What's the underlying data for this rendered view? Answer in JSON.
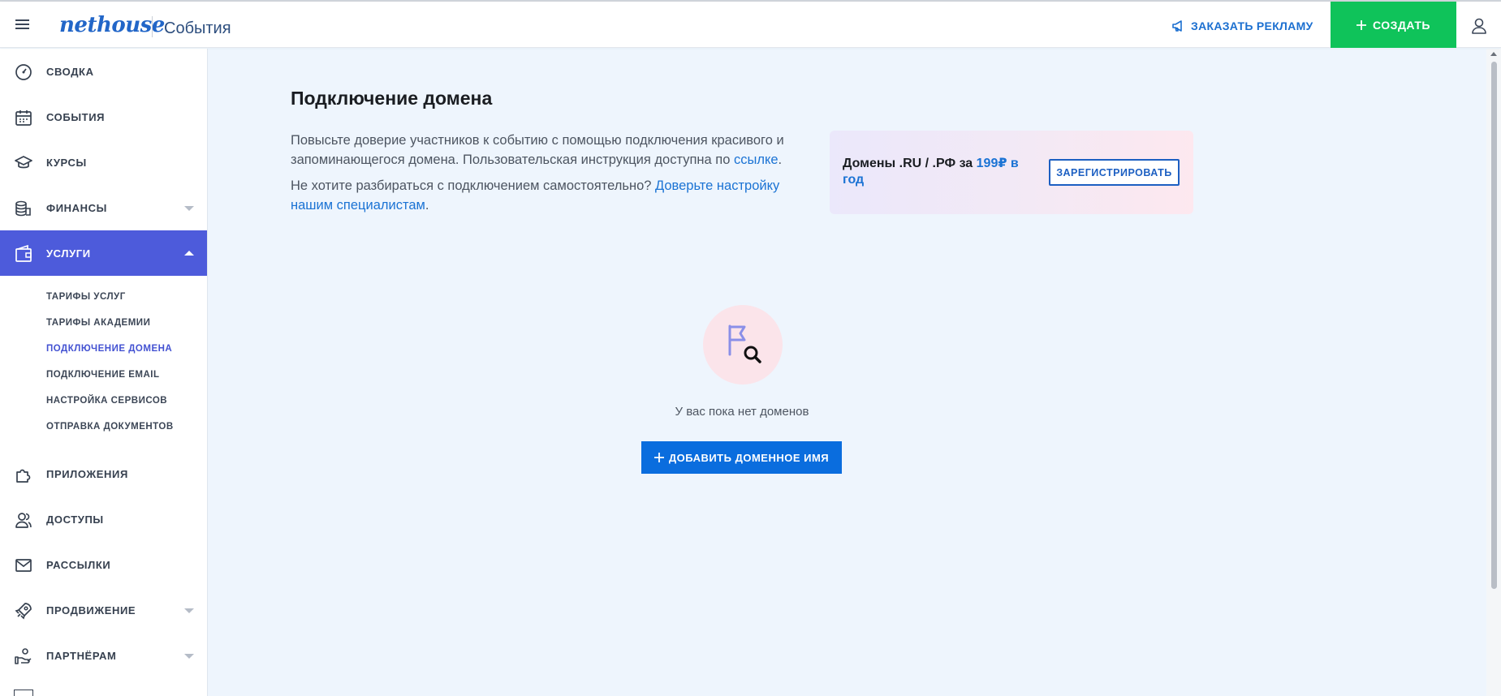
{
  "header": {
    "menu_icon": "hamburger-icon",
    "logo": "nethouse",
    "section_title": "События",
    "ad_link_label": "ЗАКАЗАТЬ РЕКЛАМУ",
    "create_button_label": "СОЗДАТЬ",
    "user_icon": "user-icon"
  },
  "sidebar": {
    "items": [
      {
        "label": "СВОДКА",
        "icon": "gauge-icon"
      },
      {
        "label": "СОБЫТИЯ",
        "icon": "calendar-icon"
      },
      {
        "label": "КУРСЫ",
        "icon": "graduation-cap-icon"
      },
      {
        "label": "ФИНАНСЫ",
        "icon": "coins-icon"
      },
      {
        "label": "УСЛУГИ",
        "icon": "wallet-icon"
      },
      {
        "label": "ПРИЛОЖЕНИЯ",
        "icon": "puzzle-icon"
      },
      {
        "label": "ДОСТУПЫ",
        "icon": "users-icon"
      },
      {
        "label": "РАССЫЛКИ",
        "icon": "envelope-icon"
      },
      {
        "label": "ПРОДВИЖЕНИЕ",
        "icon": "rocket-icon"
      },
      {
        "label": "ПАРТНЁРАМ",
        "icon": "handshake-icon"
      }
    ],
    "services_subitems": [
      "ТАРИФЫ УСЛУГ",
      "ТАРИФЫ АКАДЕМИИ",
      "ПОДКЛЮЧЕНИЕ ДОМЕНА",
      "ПОДКЛЮЧЕНИЕ EMAIL",
      "НАСТРОЙКА СЕРВИСОВ",
      "ОТПРАВКА ДОКУМЕНТОВ"
    ],
    "active_item": "УСЛУГИ",
    "active_subitem": "ПОДКЛЮЧЕНИЕ ДОМЕНА"
  },
  "main": {
    "title": "Подключение домена",
    "desc1_text": "Повысьте доверие участников к событию с помощью подключения красивого и запоминающегося домена. Пользовательская инструкция доступна по ",
    "desc1_link": "ссылке",
    "desc1_end": ".",
    "desc2_text": "Не хотите разбираться с подключением самостоятельно? ",
    "desc2_link": "Доверьте настройку нашим специалистам",
    "desc2_end": ".",
    "promo": {
      "text": "Домены .RU / .РФ за ",
      "price": "199₽ в год",
      "button_label": "ЗАРЕГИСТРИРОВАТЬ"
    },
    "empty_state": {
      "icon": "flag-search-icon",
      "text": "У вас пока нет доменов",
      "button_label": "ДОБАВИТЬ ДОМЕННОЕ ИМЯ"
    }
  },
  "colors": {
    "accent": "#4d5bdb",
    "create_green": "#0fc35a",
    "primary_blue": "#0a6dde",
    "link_blue": "#1b73d4",
    "page_bg": "#eef5fd"
  }
}
